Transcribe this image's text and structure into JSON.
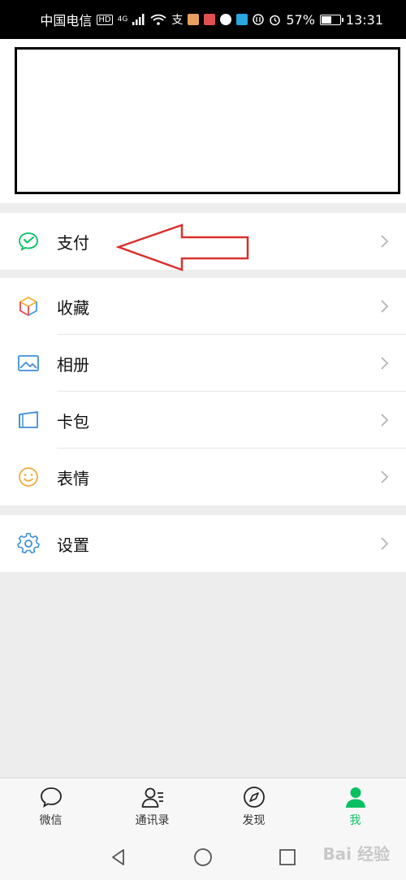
{
  "status_bar": {
    "carrier": "中国电信",
    "hd_badge": "HD",
    "network": "4G",
    "battery_percent": "57%",
    "battery_level": 0.57,
    "time": "13:31"
  },
  "menu": {
    "pay": {
      "label": "支付",
      "icon": "wechat-pay-icon"
    },
    "favorites": {
      "label": "收藏",
      "icon": "cube-icon"
    },
    "album": {
      "label": "相册",
      "icon": "picture-icon"
    },
    "cards": {
      "label": "卡包",
      "icon": "wallet-icon"
    },
    "stickers": {
      "label": "表情",
      "icon": "smiley-icon"
    },
    "settings": {
      "label": "设置",
      "icon": "gear-icon"
    }
  },
  "tabbar": {
    "chats": "微信",
    "contacts": "通讯录",
    "discover": "发现",
    "me": "我"
  },
  "colors": {
    "accent": "#07c160",
    "annotation_arrow": "#d9302c"
  },
  "watermark": "Bai 经验"
}
